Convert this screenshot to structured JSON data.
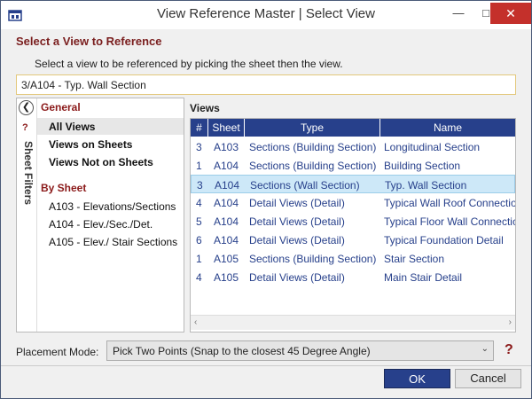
{
  "window": {
    "title": "View Reference Master | Select View",
    "minimize": "—",
    "restore": "□",
    "close": "✕"
  },
  "section_title": "Select a View to Reference",
  "instructions": "Select a view to be referenced by picking the sheet then the view.",
  "selected_value": "3/A104 - Typ. Wall Section",
  "sheet_filters": {
    "tab_label": "Sheet Filters",
    "collapse_glyph": "❮",
    "help_glyph": "?",
    "groups": [
      {
        "heading": "General",
        "items": [
          {
            "label": "All Views",
            "active": true
          },
          {
            "label": "Views on Sheets",
            "active": false
          },
          {
            "label": "Views Not on Sheets",
            "active": false
          }
        ]
      },
      {
        "heading": "By Sheet",
        "items": [
          {
            "label": "A103 - Elevations/Sections",
            "active": false
          },
          {
            "label": "A104 - Elev./Sec./Det.",
            "active": false
          },
          {
            "label": "A105 - Elev./ Stair Sections",
            "active": false
          }
        ]
      }
    ]
  },
  "views": {
    "label": "Views",
    "columns": [
      "#",
      "Sheet",
      "Type",
      "Name"
    ],
    "rows": [
      {
        "num": "3",
        "sheet": "A103",
        "type": "Sections (Building Section)",
        "name": "Longitudinal Section",
        "selected": false
      },
      {
        "num": "1",
        "sheet": "A104",
        "type": "Sections (Building Section)",
        "name": "Building Section",
        "selected": false
      },
      {
        "num": "3",
        "sheet": "A104",
        "type": "Sections (Wall Section)",
        "name": "Typ. Wall Section",
        "selected": true
      },
      {
        "num": "4",
        "sheet": "A104",
        "type": "Detail Views (Detail)",
        "name": "Typical Wall Roof Connectio",
        "selected": false
      },
      {
        "num": "5",
        "sheet": "A104",
        "type": "Detail Views (Detail)",
        "name": "Typical Floor Wall Connectic",
        "selected": false
      },
      {
        "num": "6",
        "sheet": "A104",
        "type": "Detail Views (Detail)",
        "name": "Typical Foundation Detail",
        "selected": false
      },
      {
        "num": "1",
        "sheet": "A105",
        "type": "Sections (Building Section)",
        "name": "Stair Section",
        "selected": false
      },
      {
        "num": "4",
        "sheet": "A105",
        "type": "Detail Views (Detail)",
        "name": "Main Stair Detail",
        "selected": false
      }
    ],
    "scroll_left": "‹",
    "scroll_right": "›"
  },
  "placement": {
    "label": "Placement Mode:",
    "value": "Pick Two Points (Snap to the closest 45 Degree Angle)",
    "help_glyph": "?"
  },
  "buttons": {
    "ok": "OK",
    "cancel": "Cancel"
  },
  "colors": {
    "header_blue": "#27408b",
    "accent_red": "#8b1a1a",
    "selection": "#cde8f8"
  }
}
